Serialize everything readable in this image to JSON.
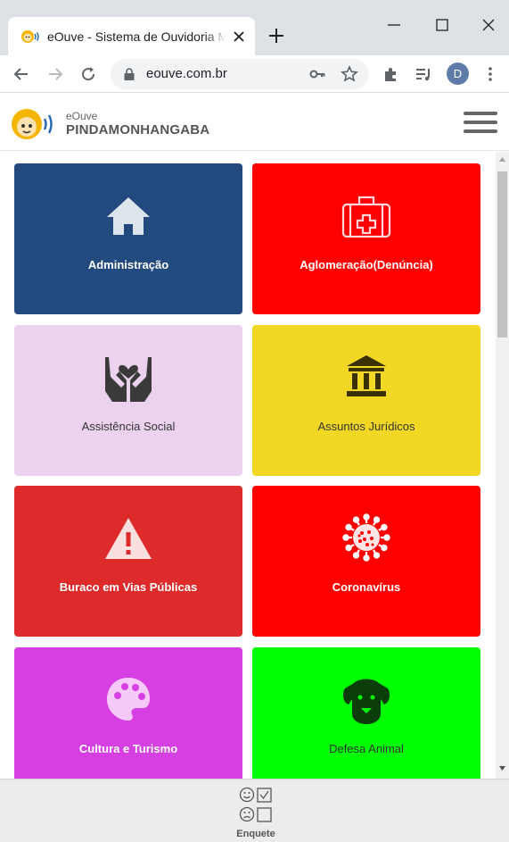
{
  "browser": {
    "tab_title": "eOuve - Sistema de Ouvidoria M",
    "url": "eouve.com.br",
    "profile_initial": "D"
  },
  "header": {
    "brand_small": "eOuve",
    "brand_city": "PINDAMONHANGABA"
  },
  "categories": [
    {
      "label": "Administração",
      "icon": "house-icon",
      "bg": "#234a7e",
      "fg": "#ffffff",
      "bold": true
    },
    {
      "label": "Aglomeração(Denúncia)",
      "icon": "first-aid-kit-icon",
      "bg": "#ff0000",
      "fg": "#ffffff",
      "bold": true
    },
    {
      "label": "Assistência Social",
      "icon": "hands-heart-icon",
      "bg": "#ecd2ee",
      "fg": "#333333",
      "bold": false
    },
    {
      "label": "Assuntos Jurídicos",
      "icon": "courthouse-icon",
      "bg": "#f2d824",
      "fg": "#333333",
      "bold": false
    },
    {
      "label": "Buraco em Vias Públicas",
      "icon": "warning-icon",
      "bg": "#dd2a2a",
      "fg": "#ffffff",
      "bold": true
    },
    {
      "label": "Coronavírus",
      "icon": "virus-icon",
      "bg": "#ff0000",
      "fg": "#ffffff",
      "bold": true
    },
    {
      "label": "Cultura e Turismo",
      "icon": "palette-icon",
      "bg": "#d63fe1",
      "fg": "#ffffff",
      "bold": true
    },
    {
      "label": "Defesa Animal",
      "icon": "dog-icon",
      "bg": "#00ff00",
      "fg": "#333333",
      "bold": false
    }
  ],
  "bottom": {
    "survey_label": "Enquete"
  }
}
